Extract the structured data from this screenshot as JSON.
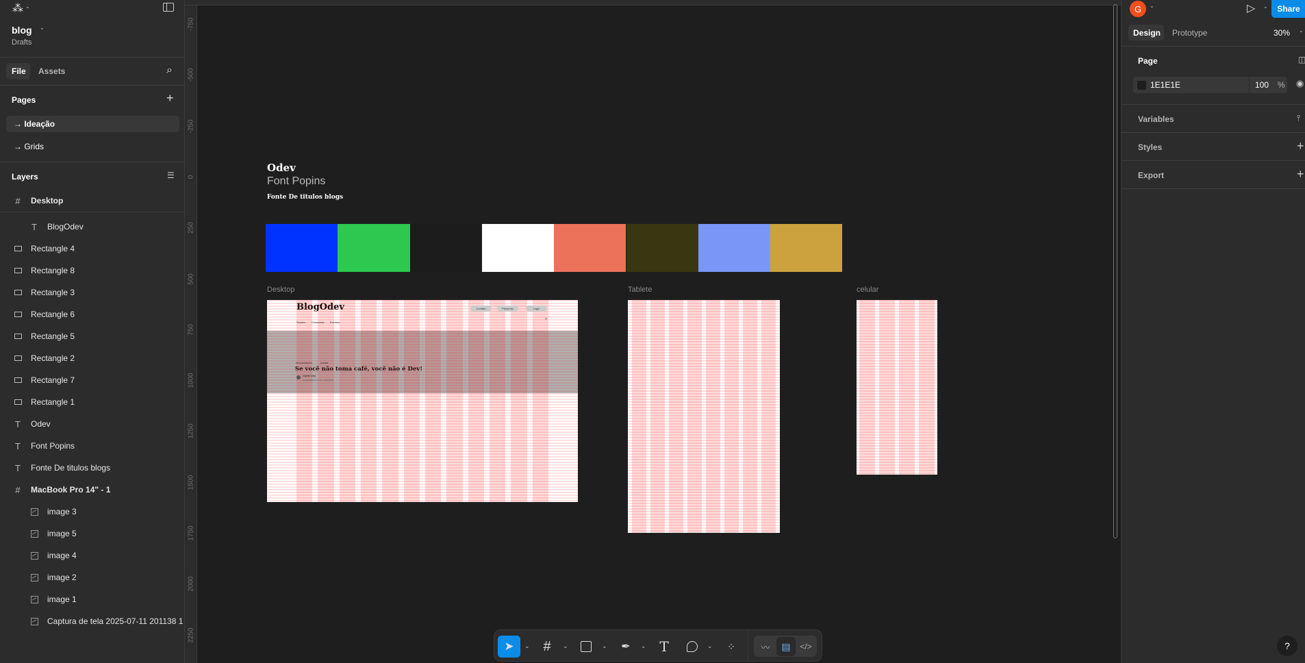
{
  "app": {
    "file_name": "blog",
    "location": "Drafts"
  },
  "left_panel": {
    "tabs": [
      {
        "label": "File",
        "active": true
      },
      {
        "label": "Assets",
        "active": false
      }
    ],
    "pages_title": "Pages",
    "pages": [
      {
        "label": "→ Ideação",
        "active": true
      },
      {
        "label": "→ Grids",
        "active": false
      }
    ],
    "layers_title": "Layers",
    "layers": [
      {
        "label": "Desktop",
        "type": "frame",
        "bold": true
      },
      {
        "label": "BlogOdev",
        "type": "text",
        "indent": true
      },
      {
        "label": "Rectangle 4",
        "type": "rect"
      },
      {
        "label": "Rectangle 8",
        "type": "rect"
      },
      {
        "label": "Rectangle 3",
        "type": "rect"
      },
      {
        "label": "Rectangle 6",
        "type": "rect"
      },
      {
        "label": "Rectangle 5",
        "type": "rect"
      },
      {
        "label": "Rectangle 2",
        "type": "rect"
      },
      {
        "label": "Rectangle 7",
        "type": "rect"
      },
      {
        "label": "Rectangle 1",
        "type": "rect"
      },
      {
        "label": "Odev",
        "type": "text"
      },
      {
        "label": "Font Popins",
        "type": "text"
      },
      {
        "label": "Fonte De titulos blogs",
        "type": "text"
      },
      {
        "label": "MacBook Pro 14\" - 1",
        "type": "frame",
        "bold": true
      },
      {
        "label": "image 3",
        "type": "image",
        "indent": true
      },
      {
        "label": "image 5",
        "type": "image",
        "indent": true
      },
      {
        "label": "image 4",
        "type": "image",
        "indent": true
      },
      {
        "label": "image 2",
        "type": "image",
        "indent": true
      },
      {
        "label": "image 1",
        "type": "image",
        "indent": true
      },
      {
        "label": "Captura de tela 2025-07-11 201138 1",
        "type": "image",
        "indent": true
      }
    ]
  },
  "ruler": {
    "vertical_labels": [
      "-750",
      "-500",
      "-250",
      "0",
      "250",
      "500",
      "750",
      "1000",
      "1250",
      "1500",
      "1750",
      "2000",
      "2250"
    ]
  },
  "canvas": {
    "title": "Odev",
    "subtitle": "Font Popins",
    "caption": "Fonte De titulos blogs",
    "swatches": [
      "#0033FF",
      "#2DC84F",
      "#1C1C1C",
      "#FFFFFF",
      "#EC735A",
      "#393711",
      "#7A97F7",
      "#CBA23D"
    ],
    "frames": {
      "desktop": "Desktop",
      "tablet": "Tablete",
      "mobile": "celular"
    },
    "mock": {
      "logo": "BlogOdev",
      "nav_buttons": [
        "Contato",
        "Parcerias",
        "Login"
      ],
      "menu": [
        "Seções ·",
        "Colunistas ·",
        "Eventos ·"
      ],
      "tags": [
        "PROGRAMAÇÃO",
        "HUMOR"
      ],
      "headline": "Se você não toma café, você não é Dev!",
      "author": "Gabriel silva",
      "date": "06 FEVEREIRO DE 2025 · 24:50:05 PM"
    }
  },
  "right_panel": {
    "avatar_letter": "G",
    "avatar_color": "#F24E1E",
    "share_label": "Share",
    "share_color": "#0C8CE9",
    "tabs": [
      {
        "label": "Design",
        "active": true
      },
      {
        "label": "Prototype",
        "active": false
      }
    ],
    "zoom": "30%",
    "page_section": "Page",
    "page_color": "1E1E1E",
    "page_opacity": "100",
    "percent": "%",
    "sections": [
      "Variables",
      "Styles",
      "Export"
    ]
  },
  "toolbar": {
    "tools": [
      "move",
      "frame",
      "rectangle",
      "pen",
      "text",
      "comment",
      "actions"
    ],
    "modes": [
      "draw",
      "design",
      "dev-mode"
    ],
    "active_tool": "move",
    "active_mode": "design"
  },
  "help": "?"
}
